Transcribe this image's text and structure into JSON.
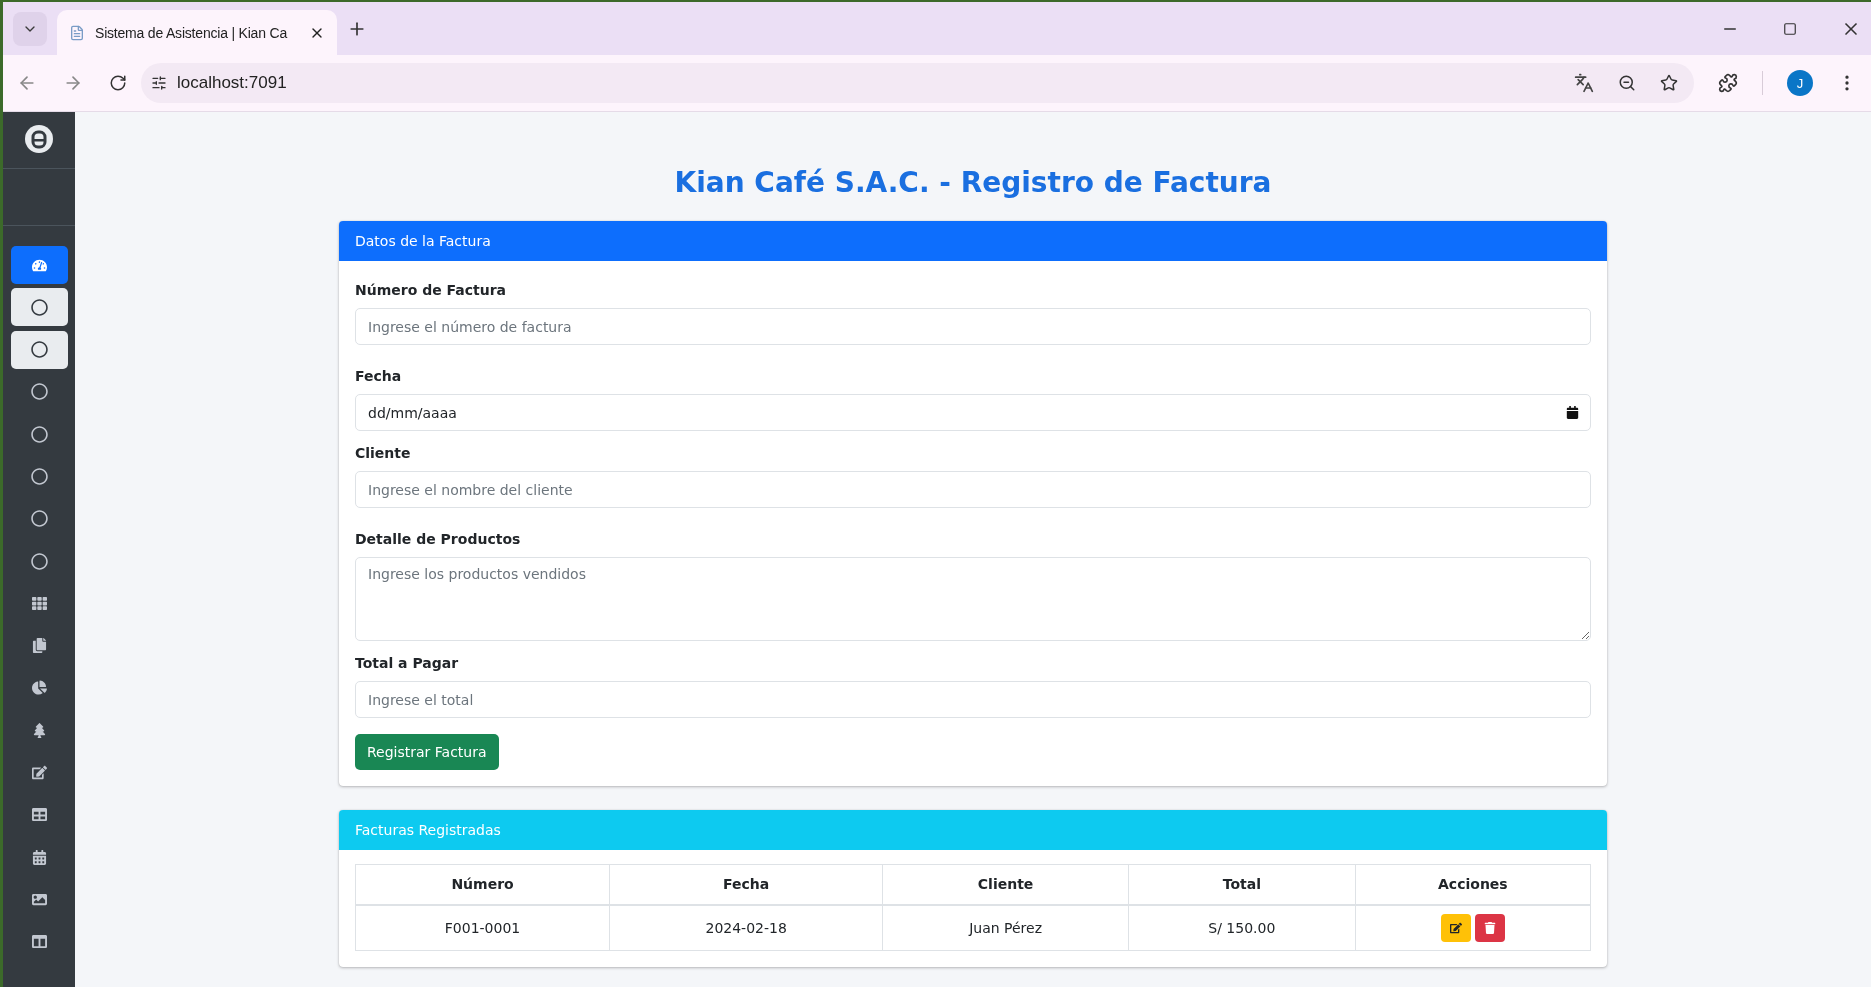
{
  "browser": {
    "tab_title": "Sistema de Asistencia | Kian Ca",
    "url": "localhost:7091",
    "profile_initial": "J"
  },
  "sidebar": {
    "items": [
      {
        "selected": true,
        "open": false
      },
      {
        "selected": false,
        "open": true
      },
      {
        "selected": false,
        "open": true
      },
      {
        "selected": false,
        "open": false
      },
      {
        "selected": false,
        "open": false
      },
      {
        "selected": false,
        "open": false
      },
      {
        "selected": false,
        "open": false
      },
      {
        "selected": false,
        "open": false
      },
      {
        "selected": false,
        "open": false
      },
      {
        "selected": false,
        "open": false
      },
      {
        "selected": false,
        "open": false
      },
      {
        "selected": false,
        "open": false
      },
      {
        "selected": false,
        "open": false
      },
      {
        "selected": false,
        "open": false
      },
      {
        "selected": false,
        "open": false
      },
      {
        "selected": false,
        "open": false
      },
      {
        "selected": false,
        "open": false
      }
    ]
  },
  "page_title": "Kian Café S.A.C. - Registro de Factura",
  "form_card": {
    "header": "Datos de la Factura",
    "fields": [
      {
        "kind": "text",
        "label": "Número de Factura",
        "placeholder": "Ingrese el número de factura"
      },
      {
        "kind": "date",
        "label": "Fecha",
        "placeholder": "dd/mm/aaaa"
      },
      {
        "kind": "text",
        "label": "Cliente",
        "placeholder": "Ingrese el nombre del cliente"
      },
      {
        "kind": "textarea",
        "label": "Detalle de Productos",
        "placeholder": "Ingrese los productos vendidos"
      },
      {
        "kind": "text",
        "label": "Total a Pagar",
        "placeholder": "Ingrese el total"
      }
    ],
    "submit": "Registrar Factura"
  },
  "table_card": {
    "header": "Facturas Registradas",
    "columns": [
      "Número",
      "Fecha",
      "Cliente",
      "Total",
      "Acciones"
    ],
    "rows": [
      {
        "cells": [
          "F001-0001",
          "2024-02-18",
          "Juan Pérez",
          "S/ 150.00"
        ]
      }
    ]
  }
}
